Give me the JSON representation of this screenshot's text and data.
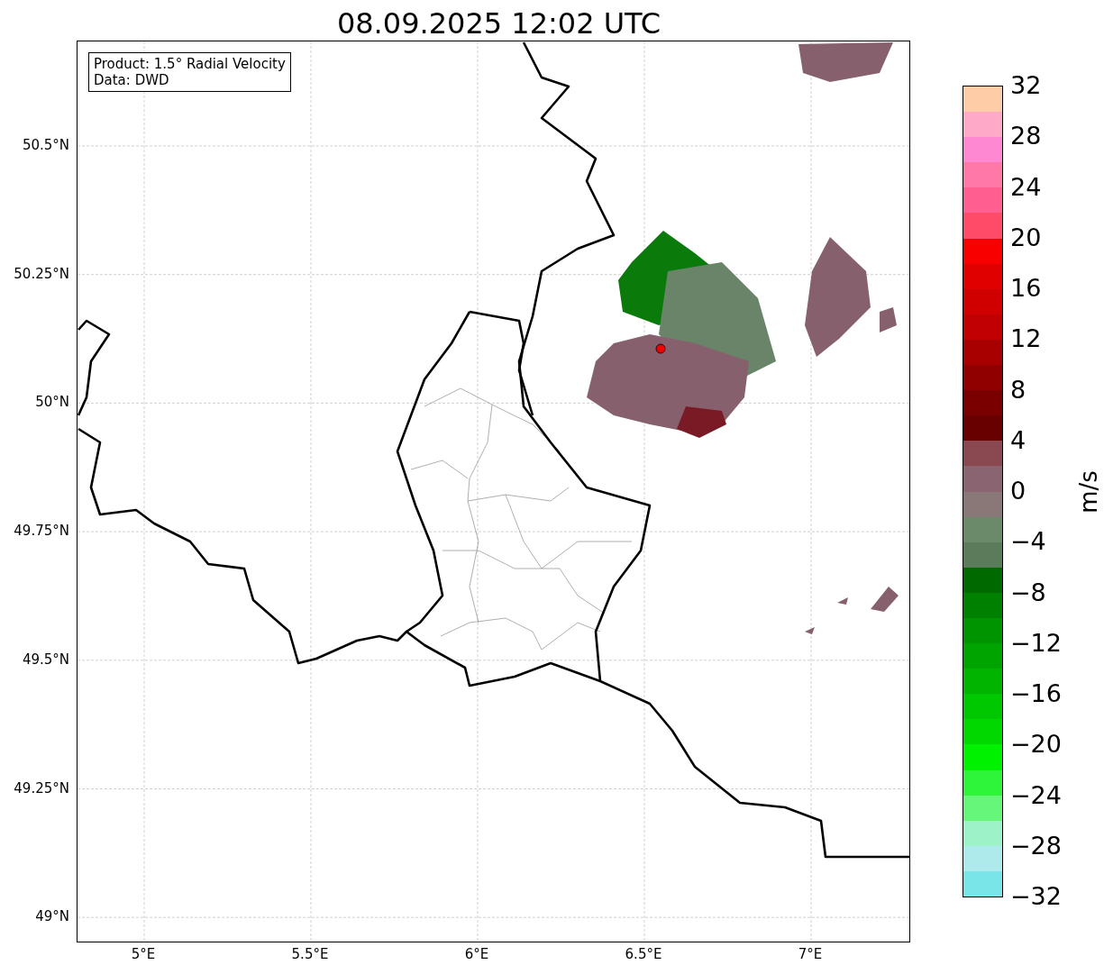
{
  "title": "08.09.2025 12:02 UTC",
  "info_box": [
    "Product: 1.5° Radial Velocity",
    "Data: DWD"
  ],
  "map": {
    "latitude_ticks": [
      "50.5°N",
      "50.25°N",
      "50°N",
      "49.75°N",
      "49.5°N",
      "49.25°N",
      "49°N"
    ],
    "longitude_ticks": [
      "5°E",
      "5.5°E",
      "6°E",
      "6.5°E",
      "7°E"
    ]
  },
  "colorbar": {
    "label": "m/s",
    "ticks": [
      "32",
      "28",
      "24",
      "20",
      "16",
      "12",
      "8",
      "4",
      "0",
      "−4",
      "−8",
      "−12",
      "−16",
      "−20",
      "−24",
      "−28",
      "−32"
    ],
    "bins": [
      {
        "color": "#ffcca8"
      },
      {
        "color": "#ffaac8"
      },
      {
        "color": "#ff88d2"
      },
      {
        "color": "#ff78a8"
      },
      {
        "color": "#ff6090"
      },
      {
        "color": "#ff4a68"
      },
      {
        "color": "#f80000"
      },
      {
        "color": "#e00000"
      },
      {
        "color": "#d00000"
      },
      {
        "color": "#c00000"
      },
      {
        "color": "#a80000"
      },
      {
        "color": "#900000"
      },
      {
        "color": "#7a0000"
      },
      {
        "color": "#680000"
      },
      {
        "color": "#8a4850"
      },
      {
        "color": "#8a6470"
      },
      {
        "color": "#8a7878"
      },
      {
        "color": "#6a8a6a"
      },
      {
        "color": "#5a7c5a"
      },
      {
        "color": "#006a00"
      },
      {
        "color": "#008000"
      },
      {
        "color": "#009400"
      },
      {
        "color": "#00a400"
      },
      {
        "color": "#00b400"
      },
      {
        "color": "#00c800"
      },
      {
        "color": "#00d800"
      },
      {
        "color": "#00f200"
      },
      {
        "color": "#2ef53a"
      },
      {
        "color": "#66f77a"
      },
      {
        "color": "#9ef2c8"
      },
      {
        "color": "#aee9ec"
      },
      {
        "color": "#7ae5e8"
      }
    ]
  }
}
